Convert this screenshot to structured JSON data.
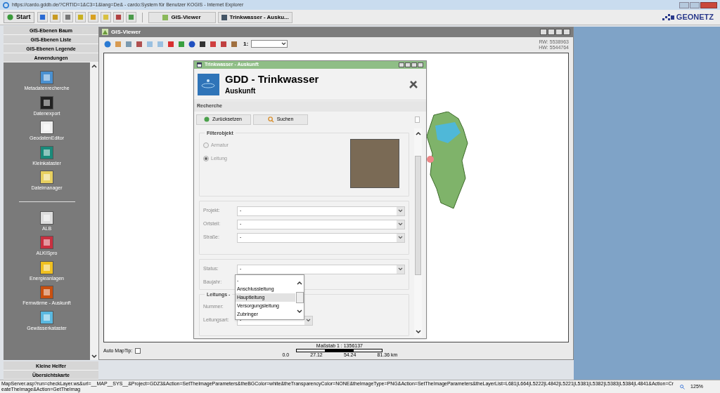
{
  "browser": {
    "title": "https://cardo.gddb.de/?CRTID=1&C3=1&lang=De& - cardo:System für Benutzer KOGIS - Internet Explorer"
  },
  "toolbar": {
    "start": "Start",
    "tasks": [
      {
        "label": "GIS-Viewer",
        "selected": false
      },
      {
        "label": "Trinkwasser - Ausku...",
        "selected": false
      }
    ],
    "logo": "GEONETZ"
  },
  "sidebar": {
    "headers": [
      "GIS-Ebenen Baum",
      "GIS-Ebenen Liste",
      "GIS-Ebenen Legende",
      "Anwendungen"
    ],
    "apps": [
      {
        "kind": "app",
        "label": "Metadatenrecherche"
      },
      {
        "kind": "app",
        "label": "Datenexport"
      },
      {
        "kind": "app",
        "label": "GeodatenEditor"
      },
      {
        "kind": "app",
        "label": "Kleinkataster"
      },
      {
        "kind": "app",
        "label": "Dateimanager"
      },
      {
        "kind": "separator"
      },
      {
        "kind": "app",
        "label": "ALB"
      },
      {
        "kind": "app",
        "label": "ALKISpro"
      },
      {
        "kind": "app",
        "label": "Energieanlagen"
      },
      {
        "kind": "app",
        "label": "Fernwärme - Auskunft"
      },
      {
        "kind": "app",
        "label": "Gewässerkataster"
      }
    ],
    "footers": [
      "Kleine Helfer",
      "Übersichtskarte"
    ]
  },
  "viewer": {
    "title": "GIS-Viewer",
    "scale_label": "1:",
    "rw": "RW: 5538963",
    "hw": "HW: 5544764",
    "auto_maptip": {
      "label": "Auto MapTip:",
      "checked": false
    },
    "scalebar": {
      "title": "Maßstab 1 : 1356137",
      "ticks": [
        "0.0",
        "27.12",
        "54.24",
        "81.36 km"
      ]
    }
  },
  "dialog": {
    "title": "Trinkwasser - Auskunft",
    "heading": "GDD - Trinkwasser",
    "subheading": "Auskunft",
    "section": "Recherche",
    "buttons": [
      "Zurücksetzen",
      "Suchen"
    ],
    "filter": {
      "legend": "Filterobjekt",
      "options": [
        {
          "label": "Armatur",
          "selected": false
        },
        {
          "label": "Leitung",
          "selected": true
        }
      ]
    },
    "fields": [
      {
        "label": "Projekt:",
        "value": "-"
      },
      {
        "label": "Ortsteil:",
        "value": "-"
      },
      {
        "label": "Straße:",
        "value": "-"
      }
    ],
    "status": {
      "label": "Status:",
      "value": "-"
    },
    "baujahr": {
      "label": "Baujahr:"
    },
    "leitung": {
      "legend": "Leitungs -",
      "nummer": "Nummer:",
      "art_label": "Leitungsart:",
      "art_value": "-"
    },
    "dropdown": [
      {
        "label": "-",
        "selected": false
      },
      {
        "label": "Anschlussleitung",
        "selected": false
      },
      {
        "label": "Hauptleitung",
        "selected": true
      },
      {
        "label": "Versorgungsleitung",
        "selected": false
      },
      {
        "label": "Zubringer",
        "selected": false
      }
    ]
  },
  "status_bar": {
    "url": "MapServer.asp?run=checkLayer.ws&url=__MAP__SYS__&Project=GDZ3&Action=SetTheImageParameters&theBGColor=white&theTransparencyColor=NONE&theImageType=PNG&Action=SetTheImageParameters&theLayerList=L681|L664|L5222|L4842|L5221|L5381|L5382|L5383|L5384|L4841&Action=CreateTheImage&Action=GetTheImag",
    "zoom": "125%"
  }
}
